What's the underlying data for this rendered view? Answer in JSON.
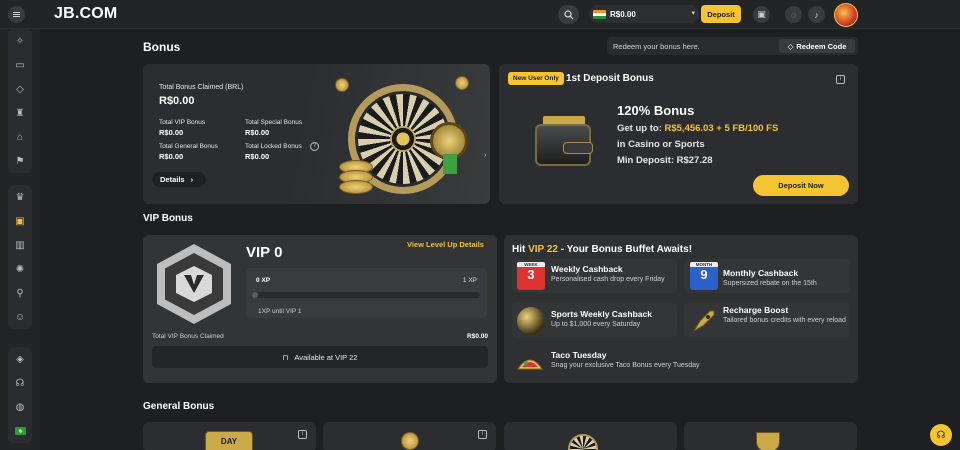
{
  "header": {
    "logo_text": "JB.COM",
    "balance": "R$0.00",
    "deposit_label": "Deposit"
  },
  "bonus": {
    "title": "Bonus",
    "redeem_placeholder": "Redeem your bonus here.",
    "redeem_button": "Redeem Code",
    "claimed": {
      "total_label": "Total Bonus Claimed (BRL)",
      "total_value": "R$0.00",
      "vip_label": "Total VIP Bonus",
      "vip_value": "R$0.00",
      "special_label": "Total Special Bonus",
      "special_value": "R$0.00",
      "general_label": "Total General Bonus",
      "general_value": "R$0.00",
      "locked_label": "Total Locked Bonus",
      "locked_value": "R$0.00",
      "details_label": "Details"
    },
    "first_deposit": {
      "badge": "New User Only",
      "title": "1st Deposit Bonus",
      "headline": "120% Bonus",
      "get_up_to_prefix": "Get up to: ",
      "get_up_to_value": "R$5,456.03 + 5 FB/100 FS",
      "where": "in Casino or Sports",
      "min_deposit": "Min Deposit: R$27.28",
      "cta": "Deposit Now"
    }
  },
  "vip": {
    "section_title": "VIP Bonus",
    "level": "VIP 0",
    "view_link": "View Level Up Details",
    "xp_current": "0 XP",
    "xp_target": "1 XP",
    "xp_progress": 0.0,
    "xp_until": "1XP until VIP 1",
    "claimed_label": "Total VIP Bonus Claimed",
    "claimed_value": "R$0.00",
    "available_label": "Available at VIP 22"
  },
  "buffet": {
    "title_prefix": "Hit ",
    "title_highlight": "VIP 22",
    "title_suffix": " - Your Bonus Buffet Awaits!",
    "perks": [
      {
        "name": "Weekly Cashback",
        "desc": "Personalised cash drop every Friday",
        "icon": "calendar-week-icon",
        "badge_top": "WEEK",
        "badge_num": "3"
      },
      {
        "name": "Monthly Cashback",
        "desc": "Supersized rebate on the 15th",
        "icon": "calendar-month-icon",
        "badge_top": "MONTH",
        "badge_num": "9"
      },
      {
        "name": "Sports Weekly Cashback",
        "desc": "Up to $1,000 every Saturday",
        "icon": "ball-icon"
      },
      {
        "name": "Recharge Boost",
        "desc": "Tailored bonus credits with every reload",
        "icon": "rocket-icon"
      },
      {
        "name": "Taco Tuesday",
        "desc": "Snag your exclusive Taco Bonus every Tuesday",
        "icon": "taco-icon"
      }
    ]
  },
  "general": {
    "section_title": "General Bonus",
    "day_label": "DAY"
  },
  "colors": {
    "accent": "#f5c431",
    "background": "#1e1f21",
    "card": "#2c2d30"
  }
}
